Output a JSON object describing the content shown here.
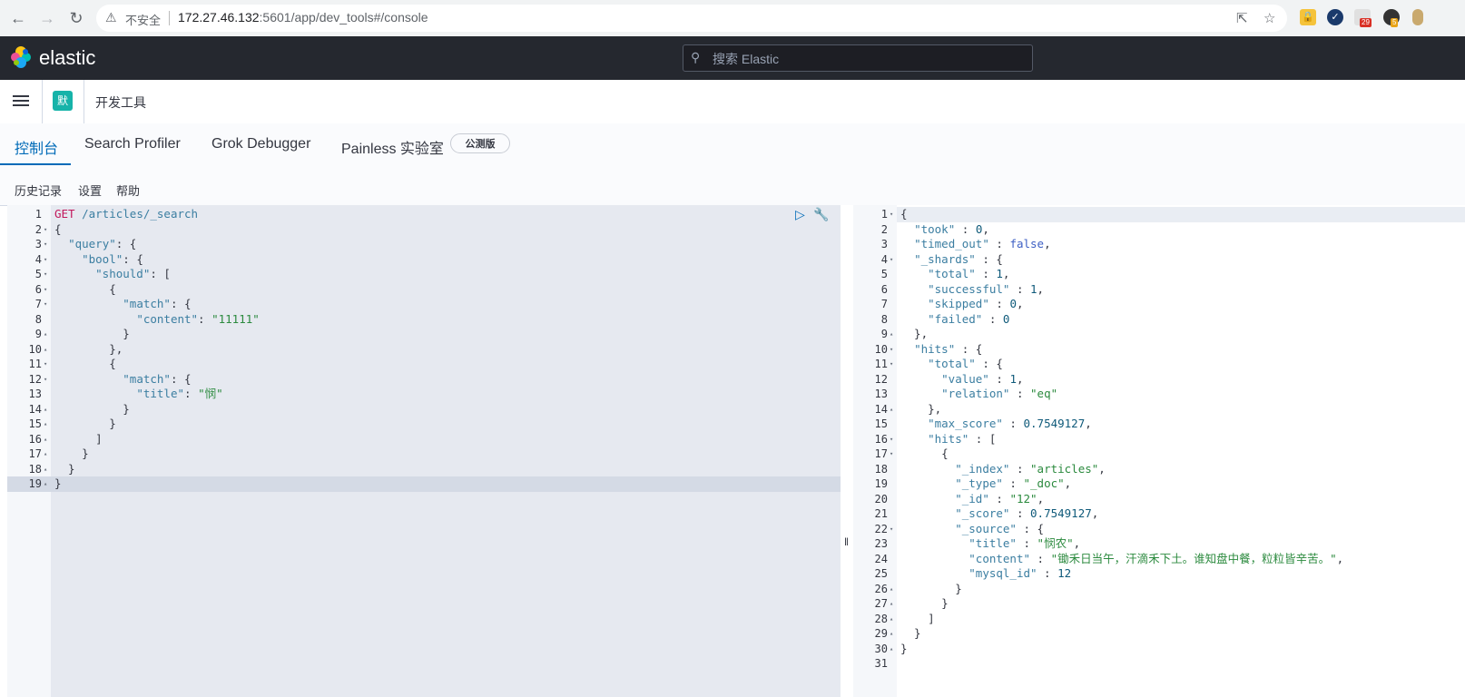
{
  "browser": {
    "insecure_label": "不安全",
    "url_host": "172.27.46.132",
    "url_rest": ":5601/app/dev_tools#/console",
    "extension_badges": [
      "29",
      "5"
    ]
  },
  "header": {
    "logo_text": "elastic",
    "search_placeholder": "搜索 Elastic"
  },
  "breadcrumb": {
    "space_avatar": "默",
    "title": "开发工具"
  },
  "tabs": [
    {
      "label": "控制台",
      "active": true
    },
    {
      "label": "Search Profiler",
      "active": false
    },
    {
      "label": "Grok Debugger",
      "active": false
    },
    {
      "label": "Painless 实验室",
      "active": false
    }
  ],
  "beta_badge": "公测版",
  "menu": {
    "history": "历史记录",
    "settings": "设置",
    "help": "帮助"
  },
  "request_lines": [
    "GET /articles/_search",
    "{",
    "  \"query\": {",
    "    \"bool\": {",
    "      \"should\": [",
    "        {",
    "          \"match\": {",
    "            \"content\": \"11111\"",
    "          }",
    "        },",
    "        {",
    "          \"match\": {",
    "            \"title\": \"悯\"",
    "          }",
    "        }",
    "      ]",
    "    }",
    "  }",
    "}"
  ],
  "response_lines": [
    "{",
    "  \"took\" : 0,",
    "  \"timed_out\" : false,",
    "  \"_shards\" : {",
    "    \"total\" : 1,",
    "    \"successful\" : 1,",
    "    \"skipped\" : 0,",
    "    \"failed\" : 0",
    "  },",
    "  \"hits\" : {",
    "    \"total\" : {",
    "      \"value\" : 1,",
    "      \"relation\" : \"eq\"",
    "    },",
    "    \"max_score\" : 0.7549127,",
    "    \"hits\" : [",
    "      {",
    "        \"_index\" : \"articles\",",
    "        \"_type\" : \"_doc\",",
    "        \"_id\" : \"12\",",
    "        \"_score\" : 0.7549127,",
    "        \"_source\" : {",
    "          \"title\" : \"悯农\",",
    "          \"content\" : \"锄禾日当午，汗滴禾下土。谁知盘中餐，粒粒皆辛苦。\",",
    "          \"mysql_id\" : 12",
    "        }",
    "      }",
    "    ]",
    "  }",
    "}",
    ""
  ],
  "colors": {
    "accent": "#006bb8",
    "header_bg": "#25282f",
    "string": "#2b8a3e",
    "key": "#3b7ea1"
  }
}
